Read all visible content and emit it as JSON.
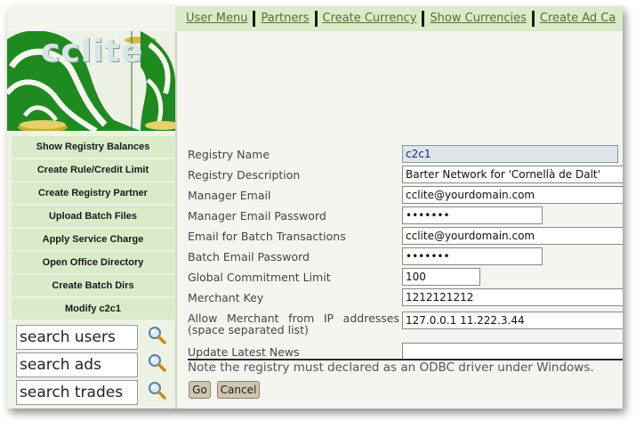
{
  "topnav": {
    "links": [
      "User Menu",
      "Partners",
      "Create Currency",
      "Show Currencies",
      "Create Ad Ca"
    ]
  },
  "logo": {
    "text": "cclite"
  },
  "sidebar": {
    "items": [
      "Show Registry Balances",
      "Create Rule/Credit Limit",
      "Create Registry Partner",
      "Upload Batch Files",
      "Apply Service Charge",
      "Open Office Directory",
      "Create Batch Dirs",
      "Modify c2c1"
    ],
    "search": [
      {
        "placeholder": "search users"
      },
      {
        "placeholder": "search ads"
      },
      {
        "placeholder": "search trades"
      }
    ]
  },
  "form": {
    "registry_name": {
      "label": "Registry Name",
      "value": "c2c1"
    },
    "registry_description": {
      "label": "Registry Description",
      "value": "Barter Network for 'Cornellà de Dalt'"
    },
    "manager_email": {
      "label": "Manager Email",
      "value": "cclite@yourdomain.com"
    },
    "manager_email_password": {
      "label": "Manager Email Password",
      "value": "•••••••"
    },
    "batch_email": {
      "label": "Email for Batch Transactions",
      "value": "cclite@yourdomain.com"
    },
    "batch_email_password": {
      "label": "Batch Email Password",
      "value": "•••••••"
    },
    "commitment_limit": {
      "label": "Global Commitment Limit",
      "value": "100"
    },
    "merchant_key": {
      "label": "Merchant Key",
      "value": "1212121212"
    },
    "merchant_ips": {
      "label": "Allow Merchant from IP addresses (space separated list)",
      "value": "127.0.0.1 11.222.3.44"
    },
    "latest_news": {
      "label": "Update Latest News",
      "value": ""
    }
  },
  "note": "Note the registry must declared as an ODBC driver under Windows.",
  "buttons": {
    "go": "Go",
    "cancel": "Cancel"
  },
  "colors": {
    "nav_bg": "#d9ebc9",
    "sidebar_bg": "#edf3e4",
    "button_bg": "#d2c6ae"
  }
}
